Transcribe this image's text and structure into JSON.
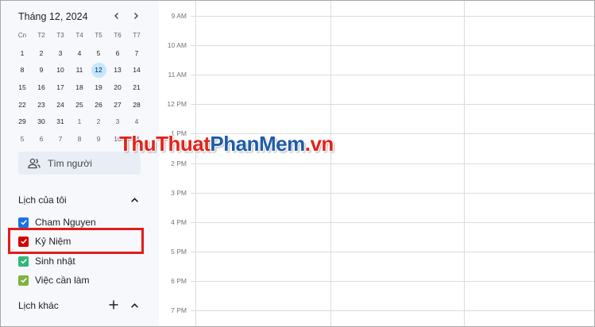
{
  "mini_calendar": {
    "title": "Tháng 12, 2024",
    "prev_icon": "chevron-left-icon",
    "next_icon": "chevron-right-icon",
    "weekdays": [
      "Cn",
      "T2",
      "T3",
      "T4",
      "T5",
      "T6",
      "T7"
    ],
    "weeks": [
      [
        "1",
        "2",
        "3",
        "4",
        "5",
        "6",
        "7"
      ],
      [
        "8",
        "9",
        "10",
        "11",
        "12",
        "13",
        "14"
      ],
      [
        "15",
        "16",
        "17",
        "18",
        "19",
        "20",
        "21"
      ],
      [
        "22",
        "23",
        "24",
        "25",
        "26",
        "27",
        "28"
      ],
      [
        "29",
        "30",
        "31",
        "1",
        "2",
        "3",
        "4"
      ],
      [
        "5",
        "6",
        "7",
        "8",
        "9",
        "10",
        "11"
      ]
    ],
    "selected_day": "12"
  },
  "search_people": {
    "label": "Tìm người",
    "icon": "people-icon"
  },
  "my_calendars": {
    "title": "Lịch của tôi",
    "items": [
      {
        "label": "Cham Nguyen",
        "color": "#1a73e8"
      },
      {
        "label": "Kỷ Niệm",
        "color": "#d50000"
      },
      {
        "label": "Sinh nhật",
        "color": "#33b679"
      },
      {
        "label": "Việc cần làm",
        "color": "#7cb342"
      }
    ]
  },
  "other_calendars": {
    "title": "Lịch khác"
  },
  "timeline": {
    "hours": [
      "9 AM",
      "10 AM",
      "11 AM",
      "12 PM",
      "1 PM",
      "2 PM",
      "3 PM",
      "4 PM",
      "5 PM",
      "6 PM",
      "7 PM"
    ]
  },
  "watermark": {
    "part1": "ThuThuat",
    "part2": "PhanMem",
    "part3": ".vn"
  },
  "colors": {
    "highlight": "#e31b1b",
    "selected_day_bg": "#c2e7ff"
  }
}
